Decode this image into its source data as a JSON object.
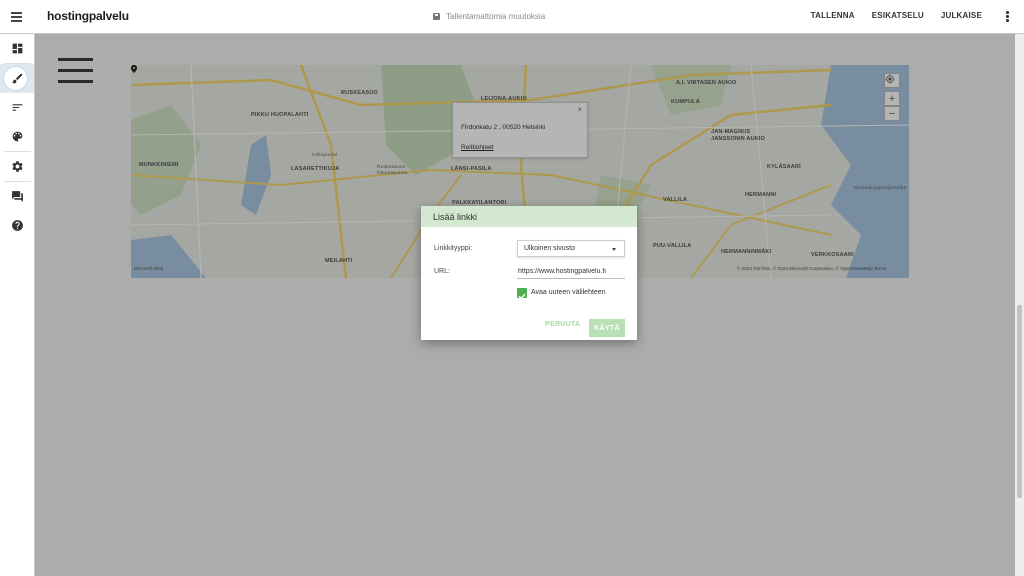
{
  "header": {
    "logo": "hostingpalvelu",
    "status_text": "Tallentamattomia muutoksia",
    "actions": [
      "TALLENNA",
      "ESIKATSELU",
      "JULKAISE"
    ]
  },
  "sidebar": {
    "items": [
      {
        "icon": "dashboard-icon"
      },
      {
        "icon": "brush-icon",
        "active": true
      },
      {
        "icon": "sort-icon"
      },
      {
        "icon": "palette-icon"
      },
      {
        "icon": "settings-icon"
      },
      {
        "icon": "chat-icon"
      },
      {
        "icon": "help-icon"
      }
    ]
  },
  "map": {
    "popup": {
      "address": "Firdonkatu 2 , 00520 Helsinki",
      "directions": "Reittiohjeet",
      "close": "×"
    },
    "labels": [
      {
        "text": "RUSKEASUO",
        "cls": ""
      },
      {
        "text": "LEIJONA-AUKIO",
        "cls": ""
      },
      {
        "text": "A.I. VIRTASEN AUKIO",
        "cls": ""
      },
      {
        "text": "KUMPULA",
        "cls": ""
      },
      {
        "text": "PIKKU HUOPALAHTI",
        "cls": ""
      },
      {
        "text": "JAN-MAGNUS JANSSONIN AUKIO",
        "cls": ""
      },
      {
        "text": "MUNKKINIEMI",
        "cls": ""
      },
      {
        "text": "LASARETTIKUJA",
        "cls": ""
      },
      {
        "text": "LÄNSI-PASILA",
        "cls": ""
      },
      {
        "text": "KYLÄSAARI",
        "cls": ""
      },
      {
        "text": "HERMANNI",
        "cls": ""
      },
      {
        "text": "Vanhankaupunginselkä",
        "cls": "small"
      },
      {
        "text": "PALKKATILANTORI",
        "cls": ""
      },
      {
        "text": "VALLILA",
        "cls": ""
      },
      {
        "text": "PUU-VALLILA",
        "cls": ""
      },
      {
        "text": "HERMANNINMÄKI",
        "cls": ""
      },
      {
        "text": "VERKKOSAARI",
        "cls": ""
      },
      {
        "text": "MEILAHTI",
        "cls": ""
      },
      {
        "text": "Tullinpuomi",
        "cls": "small"
      },
      {
        "text": "Ruskeasuon liikuntapuisto",
        "cls": "small"
      }
    ],
    "attribution_left": "Microsoft Bing",
    "attribution_right": "© 2023 TomTom, © 2023 Microsoft Corporation, © OpenStreetMap  Terms",
    "zoom_in": "+",
    "zoom_out": "−"
  },
  "dialog": {
    "title": "Lisää linkki",
    "link_type_label": "Linkkityyppi:",
    "link_type_value": "Ulkoinen sivusto",
    "url_label": "URL:",
    "url_value": "https://www.hostingpalvelu.fi",
    "new_tab_label": "Avaa uuteen välilehteen",
    "new_tab_checked": true,
    "cancel": "PERUUTA",
    "apply": "KÄYTÄ"
  },
  "colors": {
    "dialog_header": "#d2e8cf",
    "accent_green": "#4caf50",
    "overlay": "rgba(0,0,0,0.29)"
  }
}
